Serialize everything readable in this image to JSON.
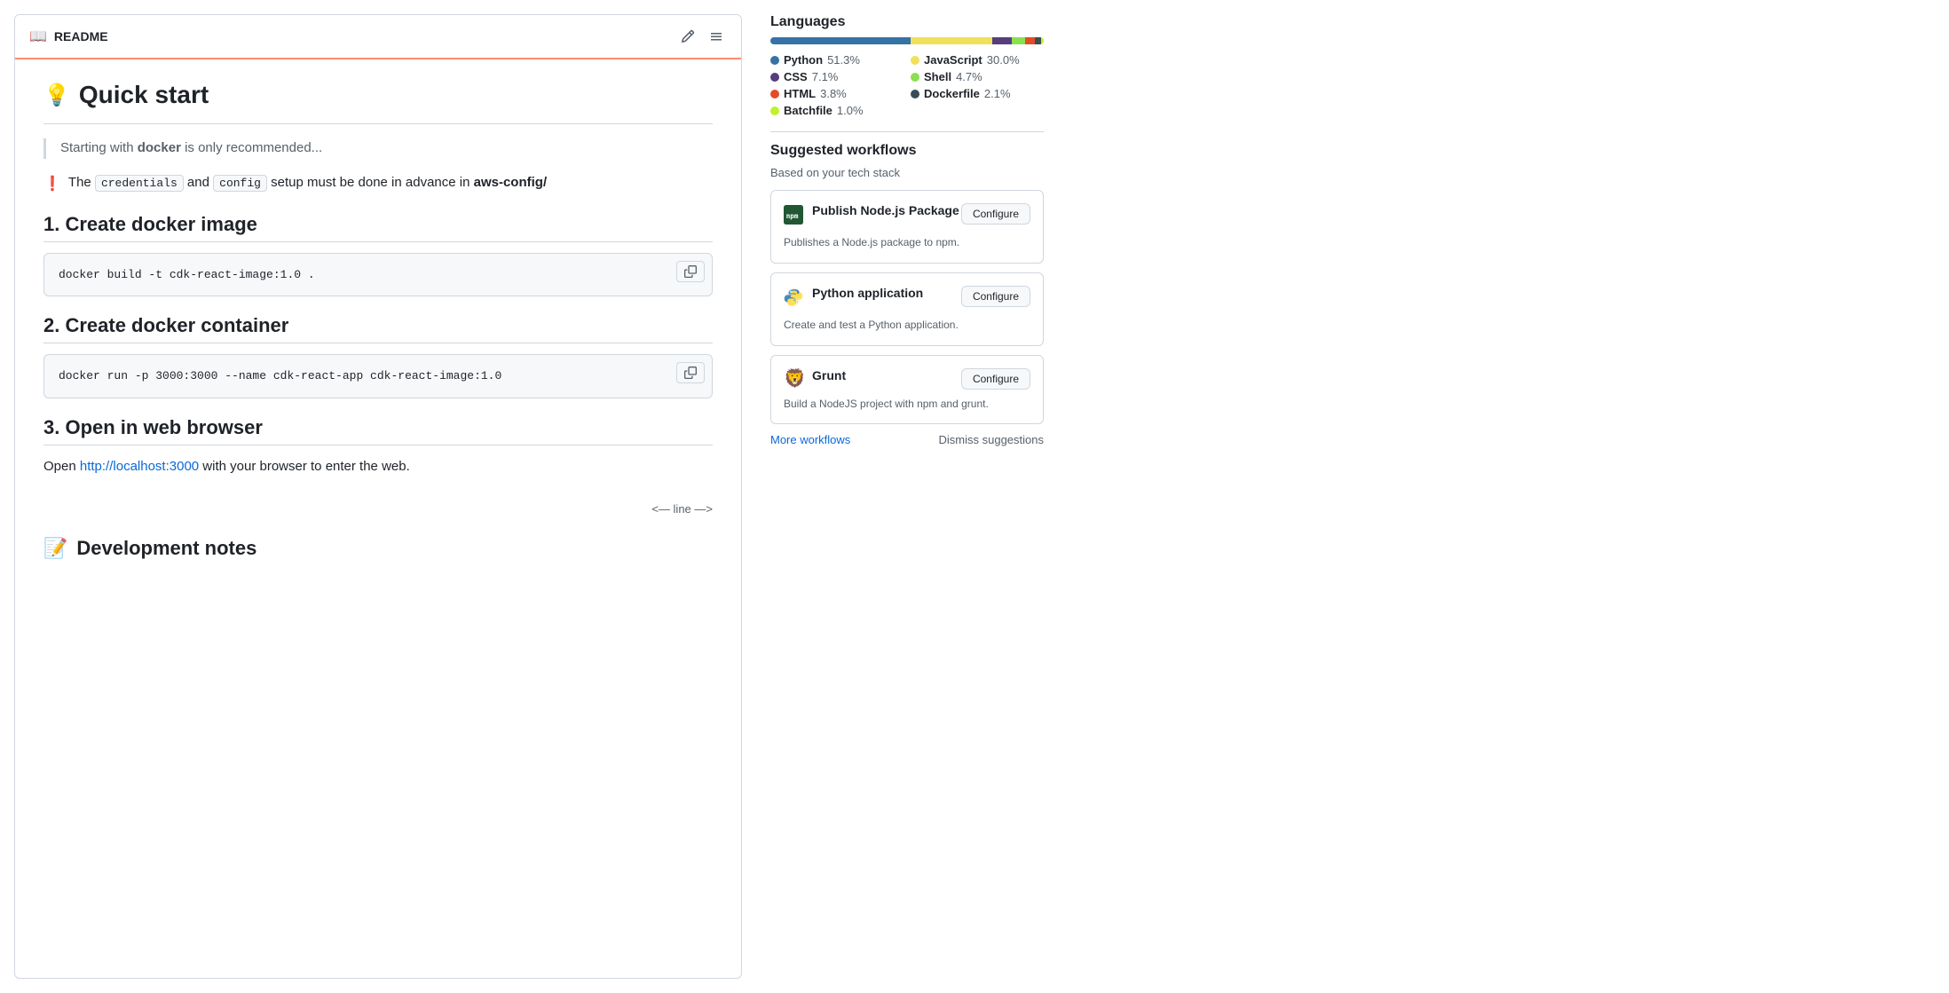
{
  "readme": {
    "title": "README",
    "quick_start": {
      "emoji": "💡",
      "heading": "Quick start",
      "blockquote": "Starting with <strong>docker</strong> is only recommended...",
      "warning_emoji": "❗",
      "warning_text_before": "The",
      "warning_code1": "credentials",
      "warning_text_mid1": "and",
      "warning_code2": "config",
      "warning_text_mid2": "setup must be done in advance in",
      "warning_bold": "aws-config/"
    },
    "sections": [
      {
        "id": "create-docker-image",
        "heading": "1. Create docker image",
        "code": "docker build -t cdk-react-image:1.0 ."
      },
      {
        "id": "create-docker-container",
        "heading": "2. Create docker container",
        "code": "docker run -p 3000:3000 --name cdk-react-app cdk-react-image:1.0"
      },
      {
        "id": "open-browser",
        "heading": "3. Open in web browser",
        "text_before_link": "Open",
        "link_text": "http://localhost:3000",
        "link_href": "http://localhost:3000",
        "text_after_link": "with your browser to enter the web."
      }
    ],
    "line_indicator": "<— line —>",
    "dev_notes": {
      "emoji": "📝",
      "heading": "Development notes"
    }
  },
  "sidebar": {
    "languages": {
      "title": "Languages",
      "bar": [
        {
          "name": "Python",
          "pct": 51.3,
          "color": "#3572A5"
        },
        {
          "name": "JavaScript",
          "pct": 30.0,
          "color": "#f1e05a"
        },
        {
          "name": "CSS",
          "pct": 7.1,
          "color": "#563d7c"
        },
        {
          "name": "Shell",
          "pct": 4.7,
          "color": "#89e051"
        },
        {
          "name": "HTML",
          "pct": 3.8,
          "color": "#e34c26"
        },
        {
          "name": "Dockerfile",
          "pct": 2.1,
          "color": "#384d54"
        },
        {
          "name": "Batchfile",
          "pct": 1.0,
          "color": "#C1F12E"
        }
      ],
      "items": [
        {
          "name": "Python",
          "pct": "51.3%",
          "color": "#3572A5"
        },
        {
          "name": "JavaScript",
          "pct": "30.0%",
          "color": "#f1e05a"
        },
        {
          "name": "CSS",
          "pct": "7.1%",
          "color": "#563d7c"
        },
        {
          "name": "Shell",
          "pct": "4.7%",
          "color": "#89e051"
        },
        {
          "name": "HTML",
          "pct": "3.8%",
          "color": "#e34c26"
        },
        {
          "name": "Dockerfile",
          "pct": "2.1%",
          "color": "#384d54"
        },
        {
          "name": "Batchfile",
          "pct": "1.0%",
          "color": "#C1F12E"
        }
      ]
    },
    "suggested_workflows": {
      "title": "Suggested workflows",
      "subtitle": "Based on your tech stack",
      "workflows": [
        {
          "id": "publish-nodejs",
          "name": "Publish Node.js Package",
          "description": "Publishes a Node.js package to npm.",
          "configure_label": "Configure",
          "icon_type": "nodejs"
        },
        {
          "id": "python-application",
          "name": "Python application",
          "description": "Create and test a Python application.",
          "configure_label": "Configure",
          "icon_type": "python"
        },
        {
          "id": "grunt",
          "name": "Grunt",
          "description": "Build a NodeJS project with npm and grunt.",
          "configure_label": "Configure",
          "icon_type": "grunt"
        }
      ],
      "more_workflows_label": "More workflows",
      "dismiss_label": "Dismiss suggestions"
    }
  }
}
